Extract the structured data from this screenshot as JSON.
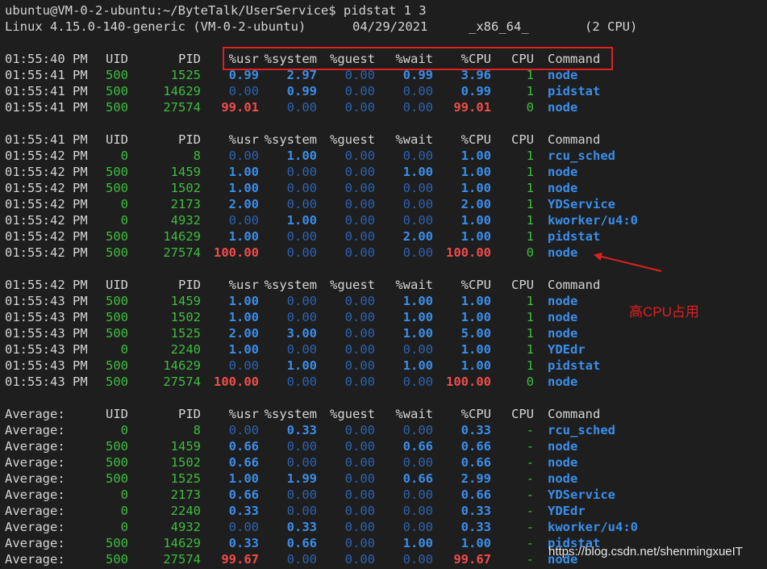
{
  "prompt_line": "ubuntu@VM-0-2-ubuntu:~/ByteTalk/UserService$ pidstat 1 3",
  "sysinfo": {
    "kernel": "Linux 4.15.0-140-generic (VM-0-2-ubuntu)",
    "date": "04/29/2021",
    "arch": "_x86_64_",
    "cpus": "(2 CPU)"
  },
  "headers": [
    "UID",
    "PID",
    "%usr",
    "%system",
    "%guest",
    "%wait",
    "%CPU",
    "CPU",
    "Command"
  ],
  "rows": [
    {
      "type": "header",
      "time": "01:55:40 PM"
    },
    {
      "type": "data",
      "time": "01:55:41 PM",
      "uid": "500",
      "pid": "1525",
      "usr": "0.99",
      "sys": "2.97",
      "guest": "0.00",
      "wait": "0.99",
      "cpu_pct": "3.96",
      "cpu": "1",
      "cmd": "node"
    },
    {
      "type": "data",
      "time": "01:55:41 PM",
      "uid": "500",
      "pid": "14629",
      "usr": "0.00",
      "sys": "0.99",
      "guest": "0.00",
      "wait": "0.00",
      "cpu_pct": "0.99",
      "cpu": "1",
      "cmd": "pidstat"
    },
    {
      "type": "data",
      "time": "01:55:41 PM",
      "uid": "500",
      "pid": "27574",
      "usr": "99.01",
      "sys": "0.00",
      "guest": "0.00",
      "wait": "0.00",
      "cpu_pct": "99.01",
      "cpu": "0",
      "cmd": "node"
    },
    {
      "type": "blank"
    },
    {
      "type": "header",
      "time": "01:55:41 PM"
    },
    {
      "type": "data",
      "time": "01:55:42 PM",
      "uid": "0",
      "pid": "8",
      "usr": "0.00",
      "sys": "1.00",
      "guest": "0.00",
      "wait": "0.00",
      "cpu_pct": "1.00",
      "cpu": "1",
      "cmd": "rcu_sched"
    },
    {
      "type": "data",
      "time": "01:55:42 PM",
      "uid": "500",
      "pid": "1459",
      "usr": "1.00",
      "sys": "0.00",
      "guest": "0.00",
      "wait": "1.00",
      "cpu_pct": "1.00",
      "cpu": "1",
      "cmd": "node"
    },
    {
      "type": "data",
      "time": "01:55:42 PM",
      "uid": "500",
      "pid": "1502",
      "usr": "1.00",
      "sys": "0.00",
      "guest": "0.00",
      "wait": "0.00",
      "cpu_pct": "1.00",
      "cpu": "1",
      "cmd": "node"
    },
    {
      "type": "data",
      "time": "01:55:42 PM",
      "uid": "0",
      "pid": "2173",
      "usr": "2.00",
      "sys": "0.00",
      "guest": "0.00",
      "wait": "0.00",
      "cpu_pct": "2.00",
      "cpu": "1",
      "cmd": "YDService"
    },
    {
      "type": "data",
      "time": "01:55:42 PM",
      "uid": "0",
      "pid": "4932",
      "usr": "0.00",
      "sys": "1.00",
      "guest": "0.00",
      "wait": "0.00",
      "cpu_pct": "1.00",
      "cpu": "1",
      "cmd": "kworker/u4:0"
    },
    {
      "type": "data",
      "time": "01:55:42 PM",
      "uid": "500",
      "pid": "14629",
      "usr": "1.00",
      "sys": "0.00",
      "guest": "0.00",
      "wait": "2.00",
      "cpu_pct": "1.00",
      "cpu": "1",
      "cmd": "pidstat"
    },
    {
      "type": "data",
      "time": "01:55:42 PM",
      "uid": "500",
      "pid": "27574",
      "usr": "100.00",
      "sys": "0.00",
      "guest": "0.00",
      "wait": "0.00",
      "cpu_pct": "100.00",
      "cpu": "0",
      "cmd": "node"
    },
    {
      "type": "blank"
    },
    {
      "type": "header",
      "time": "01:55:42 PM"
    },
    {
      "type": "data",
      "time": "01:55:43 PM",
      "uid": "500",
      "pid": "1459",
      "usr": "1.00",
      "sys": "0.00",
      "guest": "0.00",
      "wait": "1.00",
      "cpu_pct": "1.00",
      "cpu": "1",
      "cmd": "node"
    },
    {
      "type": "data",
      "time": "01:55:43 PM",
      "uid": "500",
      "pid": "1502",
      "usr": "1.00",
      "sys": "0.00",
      "guest": "0.00",
      "wait": "1.00",
      "cpu_pct": "1.00",
      "cpu": "1",
      "cmd": "node"
    },
    {
      "type": "data",
      "time": "01:55:43 PM",
      "uid": "500",
      "pid": "1525",
      "usr": "2.00",
      "sys": "3.00",
      "guest": "0.00",
      "wait": "1.00",
      "cpu_pct": "5.00",
      "cpu": "1",
      "cmd": "node"
    },
    {
      "type": "data",
      "time": "01:55:43 PM",
      "uid": "0",
      "pid": "2240",
      "usr": "1.00",
      "sys": "0.00",
      "guest": "0.00",
      "wait": "0.00",
      "cpu_pct": "1.00",
      "cpu": "1",
      "cmd": "YDEdr"
    },
    {
      "type": "data",
      "time": "01:55:43 PM",
      "uid": "500",
      "pid": "14629",
      "usr": "0.00",
      "sys": "1.00",
      "guest": "0.00",
      "wait": "1.00",
      "cpu_pct": "1.00",
      "cpu": "1",
      "cmd": "pidstat"
    },
    {
      "type": "data",
      "time": "01:55:43 PM",
      "uid": "500",
      "pid": "27574",
      "usr": "100.00",
      "sys": "0.00",
      "guest": "0.00",
      "wait": "0.00",
      "cpu_pct": "100.00",
      "cpu": "0",
      "cmd": "node"
    },
    {
      "type": "blank"
    },
    {
      "type": "header",
      "time": "Average:"
    },
    {
      "type": "data",
      "time": "Average:",
      "uid": "0",
      "pid": "8",
      "usr": "0.00",
      "sys": "0.33",
      "guest": "0.00",
      "wait": "0.00",
      "cpu_pct": "0.33",
      "cpu": "-",
      "cmd": "rcu_sched"
    },
    {
      "type": "data",
      "time": "Average:",
      "uid": "500",
      "pid": "1459",
      "usr": "0.66",
      "sys": "0.00",
      "guest": "0.00",
      "wait": "0.66",
      "cpu_pct": "0.66",
      "cpu": "-",
      "cmd": "node"
    },
    {
      "type": "data",
      "time": "Average:",
      "uid": "500",
      "pid": "1502",
      "usr": "0.66",
      "sys": "0.00",
      "guest": "0.00",
      "wait": "0.00",
      "cpu_pct": "0.66",
      "cpu": "-",
      "cmd": "node"
    },
    {
      "type": "data",
      "time": "Average:",
      "uid": "500",
      "pid": "1525",
      "usr": "1.00",
      "sys": "1.99",
      "guest": "0.00",
      "wait": "0.66",
      "cpu_pct": "2.99",
      "cpu": "-",
      "cmd": "node"
    },
    {
      "type": "data",
      "time": "Average:",
      "uid": "0",
      "pid": "2173",
      "usr": "0.66",
      "sys": "0.00",
      "guest": "0.00",
      "wait": "0.00",
      "cpu_pct": "0.66",
      "cpu": "-",
      "cmd": "YDService"
    },
    {
      "type": "data",
      "time": "Average:",
      "uid": "0",
      "pid": "2240",
      "usr": "0.33",
      "sys": "0.00",
      "guest": "0.00",
      "wait": "0.00",
      "cpu_pct": "0.33",
      "cpu": "-",
      "cmd": "YDEdr"
    },
    {
      "type": "data",
      "time": "Average:",
      "uid": "0",
      "pid": "4932",
      "usr": "0.00",
      "sys": "0.33",
      "guest": "0.00",
      "wait": "0.00",
      "cpu_pct": "0.33",
      "cpu": "-",
      "cmd": "kworker/u4:0"
    },
    {
      "type": "data",
      "time": "Average:",
      "uid": "500",
      "pid": "14629",
      "usr": "0.33",
      "sys": "0.66",
      "guest": "0.00",
      "wait": "1.00",
      "cpu_pct": "1.00",
      "cpu": "-",
      "cmd": "pidstat"
    },
    {
      "type": "data",
      "time": "Average:",
      "uid": "500",
      "pid": "27574",
      "usr": "99.67",
      "sys": "0.00",
      "guest": "0.00",
      "wait": "0.00",
      "cpu_pct": "99.67",
      "cpu": "-",
      "cmd": "node"
    }
  ],
  "annotation": "高CPU占用",
  "watermark": "https://blog.csdn.net/shenmingxueIT",
  "colors": {
    "text": "#d4d4d4",
    "green": "#3fbc3f",
    "blue_bright": "#3b8eea",
    "blue_dim": "#2d62b0",
    "red": "#f14c4c",
    "annotation": "#e0201f"
  }
}
